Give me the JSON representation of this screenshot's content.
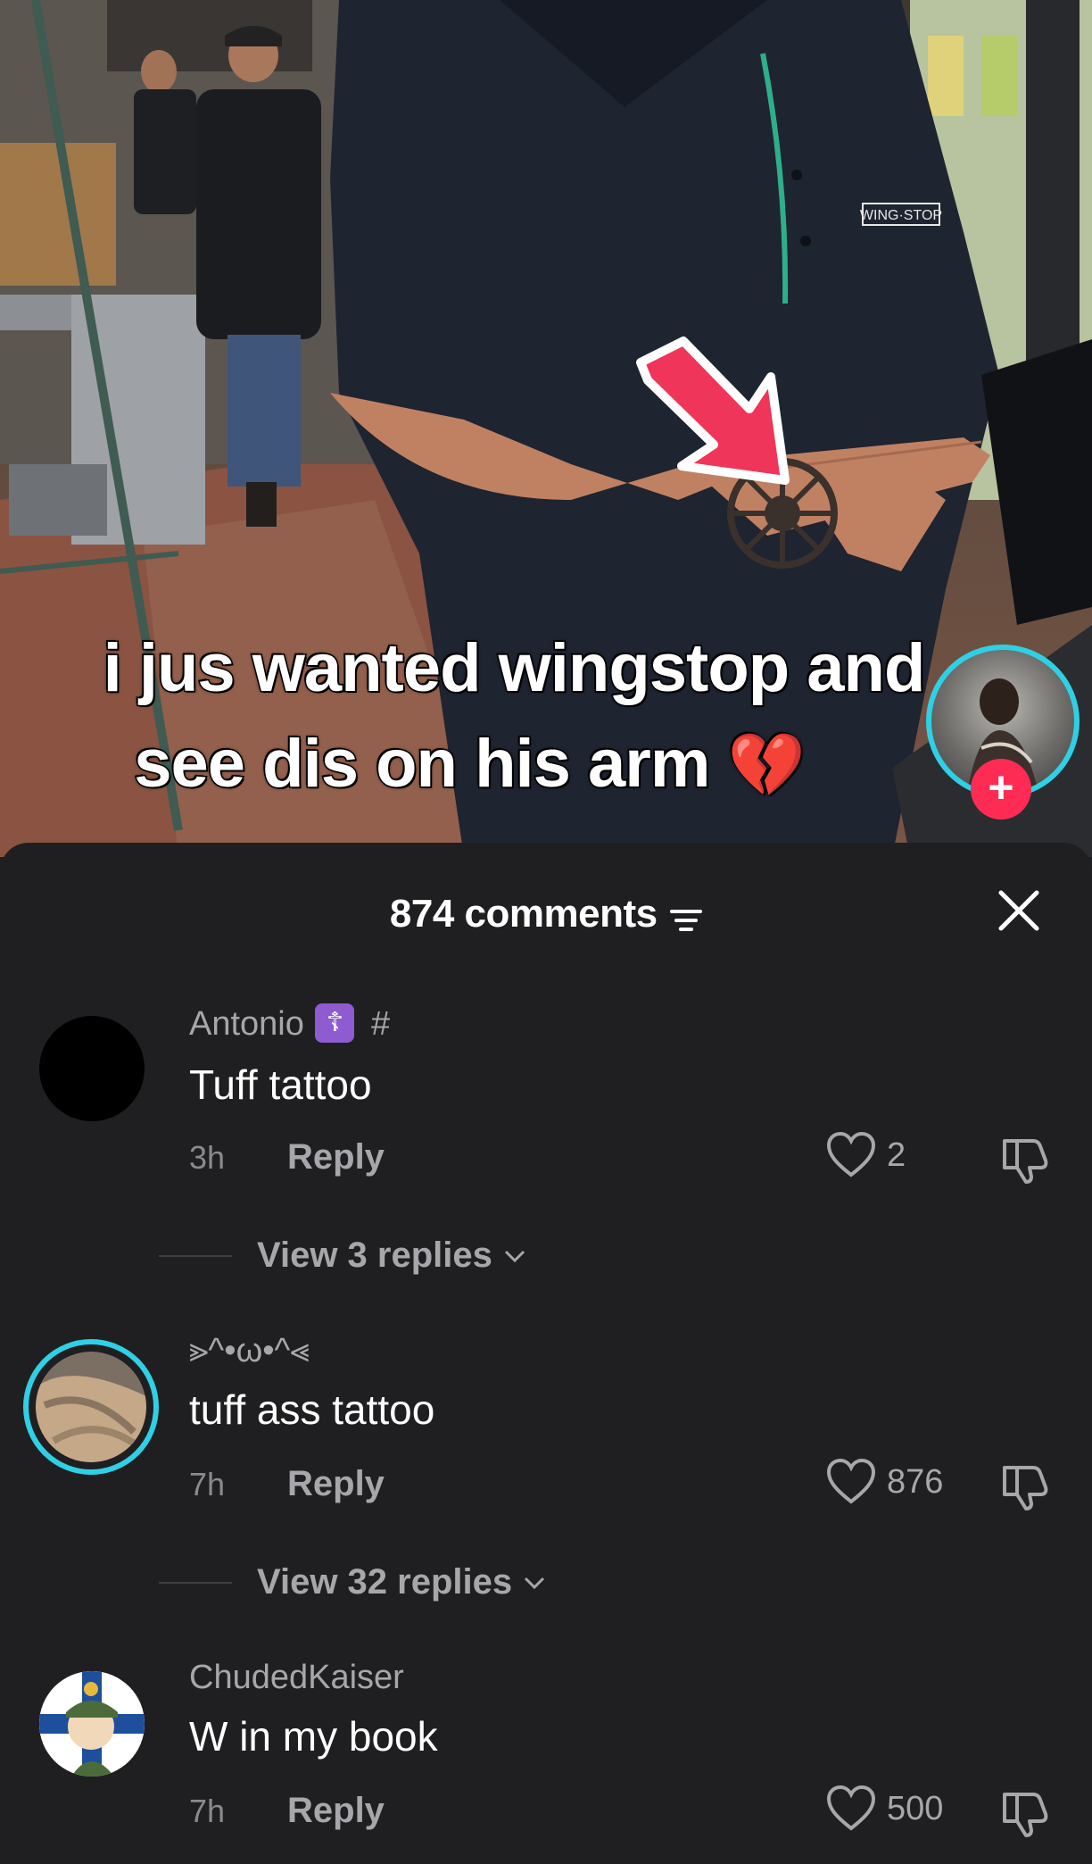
{
  "video": {
    "caption_line1": "i jus wanted wingstop and",
    "caption_line2": "see dis on his arm",
    "caption_emoji": "💔",
    "shirt_logo": "WING·STOP",
    "follow_label": "+"
  },
  "comments_sheet": {
    "count_label": "874 comments",
    "close_icon": "close-icon",
    "filter_icon": "filter-icon"
  },
  "comments": [
    {
      "username": "Antonio",
      "badge": "☦",
      "badge_suffix": "#",
      "text": "Tuff tattoo",
      "time": "3h",
      "reply_label": "Reply",
      "likes": "2",
      "view_replies": "View 3 replies",
      "avatar_color": "#000000"
    },
    {
      "username": "⪢^•ω•^⪡",
      "text": "tuff ass tattoo",
      "time": "7h",
      "reply_label": "Reply",
      "likes": "876",
      "view_replies": "View 32 replies",
      "avatar_ring_color": "#2fd0e6"
    },
    {
      "username": "ChudedKaiser",
      "text": "W in my book",
      "time": "7h",
      "reply_label": "Reply",
      "likes": "500"
    }
  ],
  "colors": {
    "background": "#1f1f21",
    "muted_text": "#a7a7ab",
    "arrow": "#f0355a",
    "follow": "#fe2c55"
  }
}
